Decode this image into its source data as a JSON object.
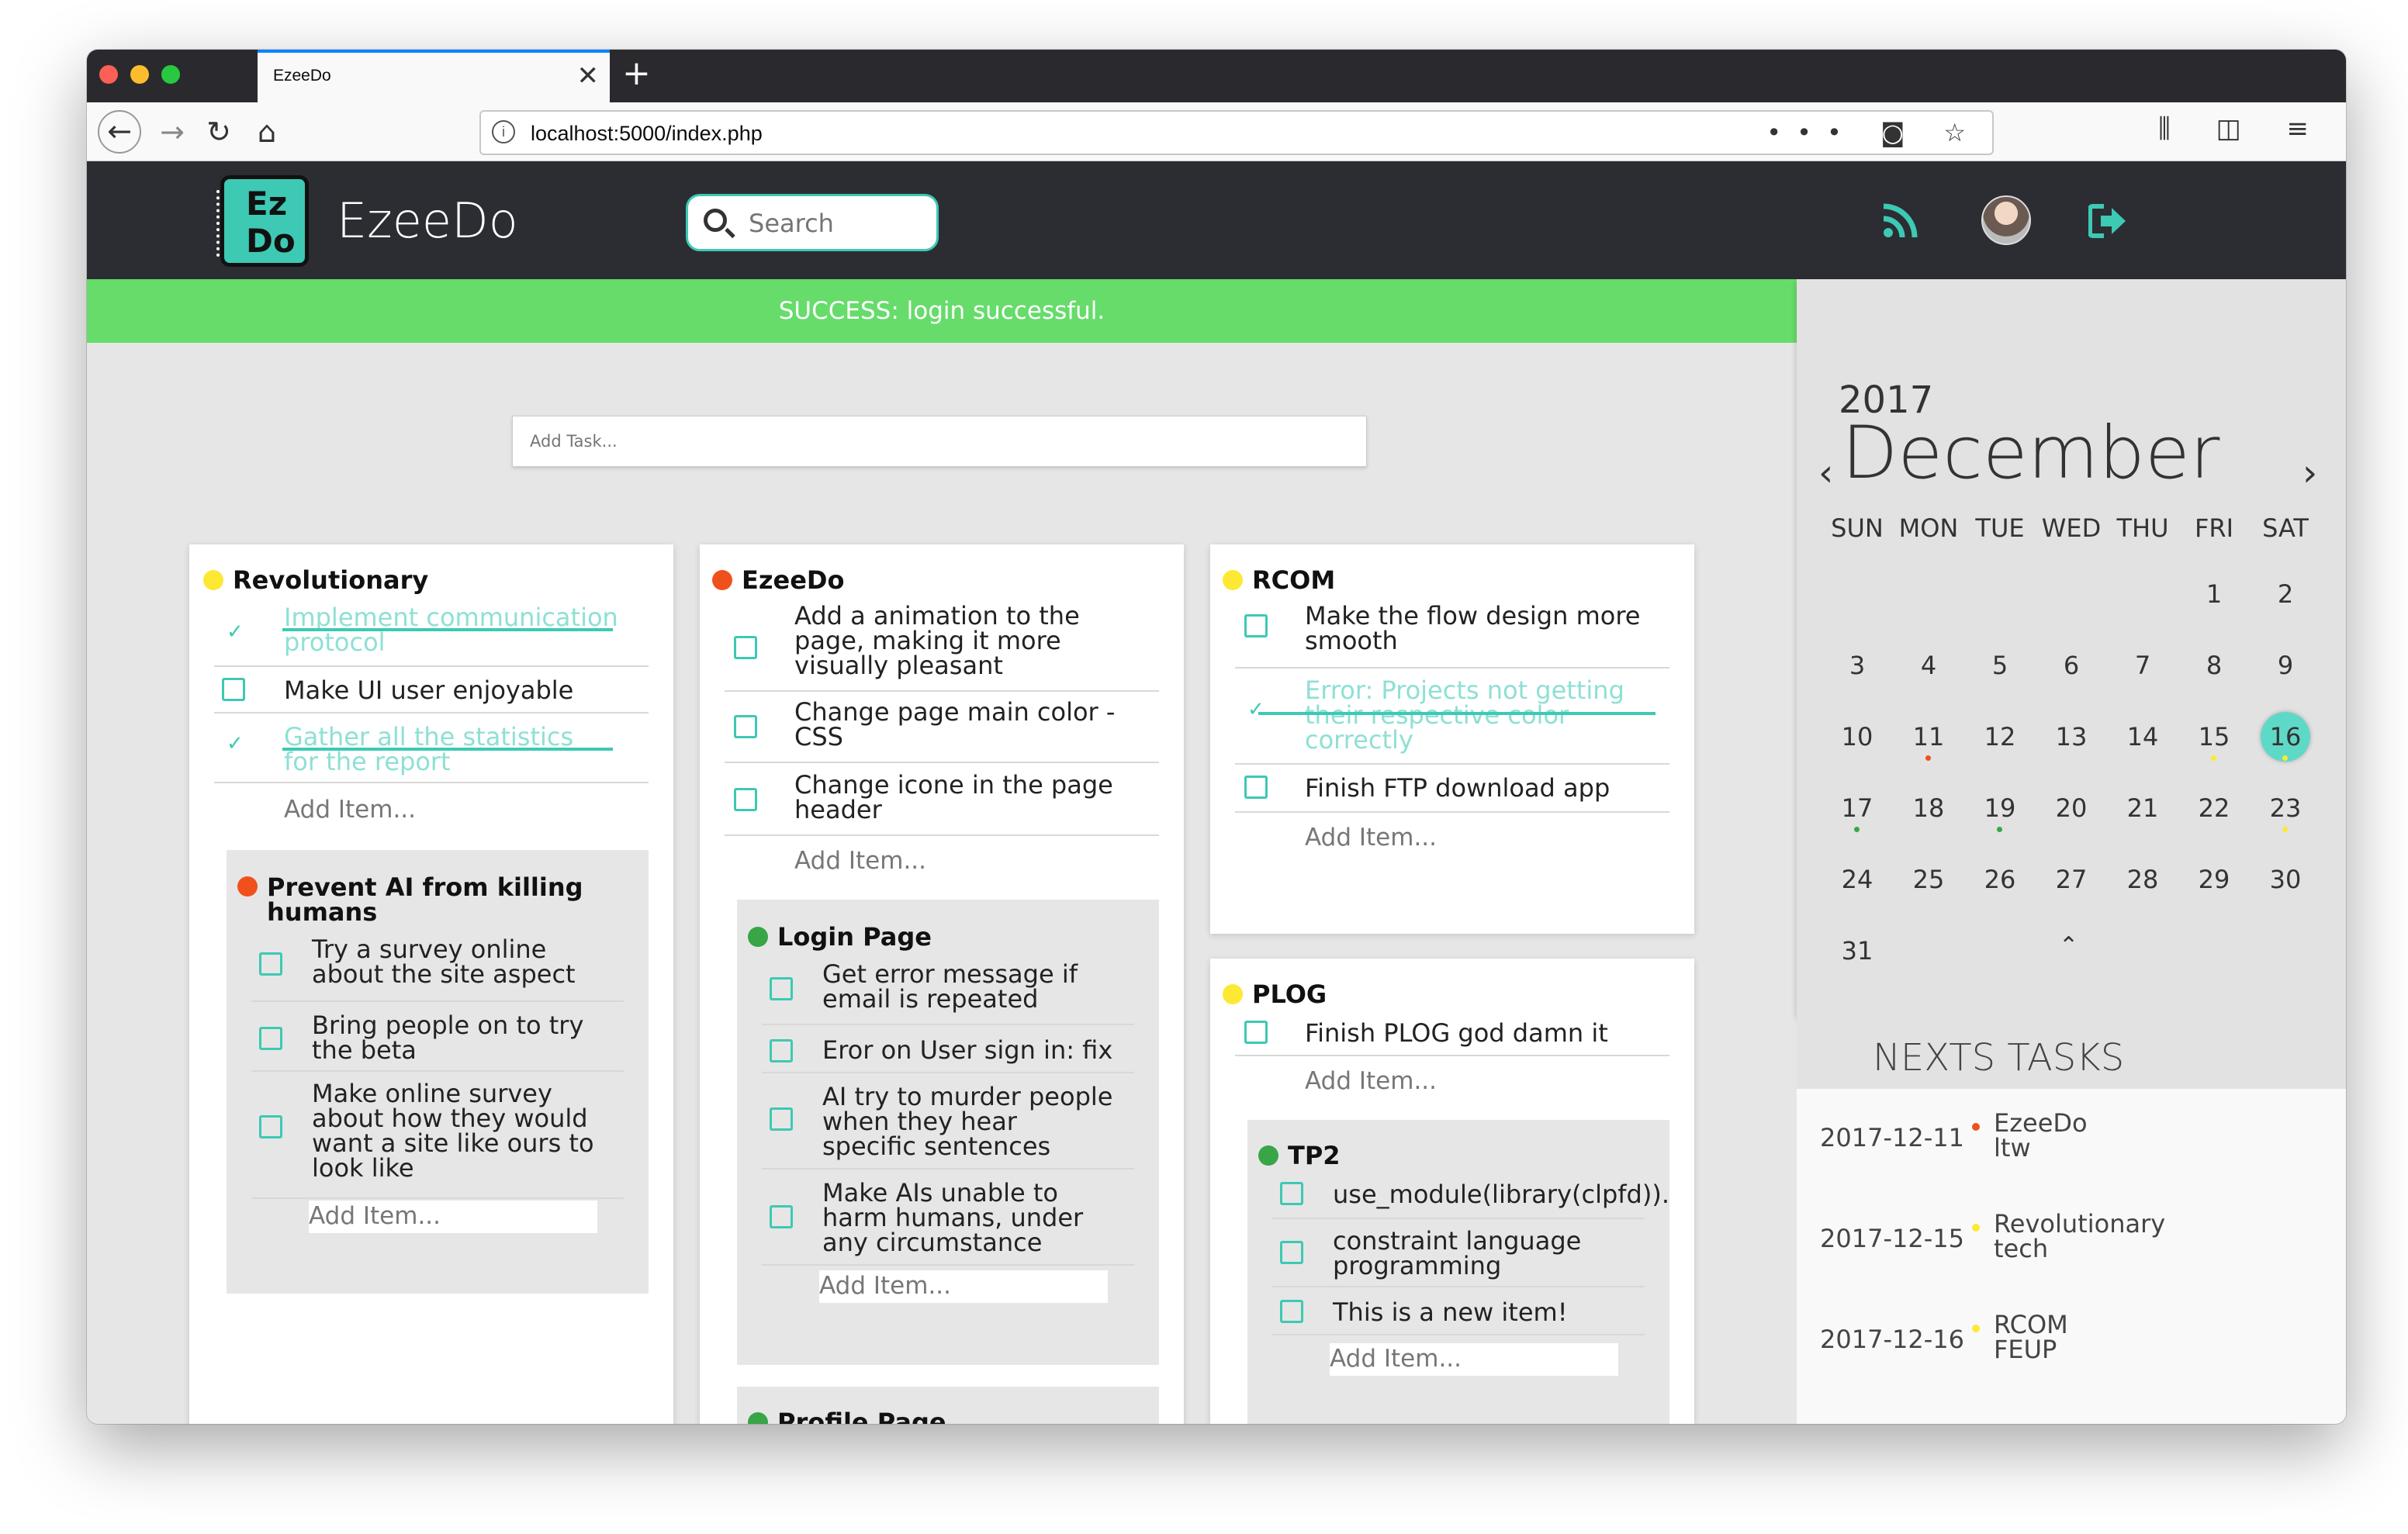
{
  "browser": {
    "tab_title": "EzeeDo",
    "close_glyph": "✕",
    "new_tab_glyph": "+",
    "url": "localhost:5000/index.php",
    "back_glyph": "←",
    "forward_glyph": "→",
    "reload_glyph": "↻",
    "home_glyph": "⌂",
    "info_glyph": "i",
    "url_icons": "••• ◙ ☆",
    "tool_icons": "⫼ ◫ ≡"
  },
  "app": {
    "logo_text": "Ez Do",
    "brand": "EzeeDo",
    "search_placeholder": "Search",
    "accent": "#3dc9b3",
    "header_bg": "#2b2d33"
  },
  "banner": {
    "text": "SUCCESS: login successful.",
    "color": "#66dc6a"
  },
  "add_task": {
    "placeholder": "Add Task..."
  },
  "projects": {
    "revolutionary": {
      "title": "Revolutionary",
      "items": [
        "Implement communication protocol",
        "Make UI user enjoyable",
        "Gather all the statistics for the report"
      ],
      "add_item": "Add Item...",
      "sub": {
        "title": "Prevent AI from killing humans",
        "items": [
          "Try a survey online about the site aspect",
          "Bring people on to try the beta",
          "Make online survey about how they would want a site like ours to look like"
        ],
        "add_item": "Add Item..."
      }
    },
    "ezeedo": {
      "title": "EzeeDo",
      "items": [
        "Add a animation to the page, making it more visually pleasant",
        "Change page main color - CSS",
        "Change icone in the page header"
      ],
      "add_item": "Add Item...",
      "sub": {
        "title": "Login Page",
        "items": [
          "Get error message if email is repeated",
          "Eror on User sign in: fix",
          "AI try to murder people when they hear specific sentences",
          "Make AIs unable to harm humans, under any circumstance"
        ],
        "add_item": "Add Item..."
      },
      "sub2_title": "Profile Page"
    },
    "rcom": {
      "title": "RCOM",
      "items": [
        "Make the flow design more smooth",
        "Error: Projects not getting their respective color correctly",
        "Finish FTP download app"
      ],
      "add_item": "Add Item..."
    },
    "plog": {
      "title": "PLOG",
      "items": [
        "Finish PLOG god damn it"
      ],
      "add_item": "Add Item...",
      "sub": {
        "title": "TP2",
        "items": [
          "use_module(library(clpfd)).",
          "constraint language programming",
          "This is a new item!"
        ],
        "add_item": "Add Item..."
      }
    }
  },
  "calendar": {
    "year": "2017",
    "month": "December",
    "prev": "‹",
    "next": "›",
    "collapse": "⌃",
    "weekdays": [
      "SUN",
      "MON",
      "TUE",
      "WED",
      "THU",
      "FRI",
      "SAT"
    ],
    "days": [
      "1",
      "2",
      "3",
      "4",
      "5",
      "6",
      "7",
      "8",
      "9",
      "10",
      "11",
      "12",
      "13",
      "14",
      "15",
      "16",
      "17",
      "18",
      "19",
      "20",
      "21",
      "22",
      "23",
      "24",
      "25",
      "26",
      "27",
      "28",
      "29",
      "30",
      "31"
    ],
    "today": "16"
  },
  "next_tasks": {
    "title": "NEXTS TASKS",
    "items": [
      {
        "date": "2017-12-11",
        "project": "EzeeDo",
        "task": "ltw",
        "color": "#f0511c"
      },
      {
        "date": "2017-12-15",
        "project": "Revolutionary",
        "task": "tech",
        "color": "#fde933"
      },
      {
        "date": "2017-12-16",
        "project": "RCOM",
        "task": "FEUP",
        "color": "#fde933"
      }
    ]
  }
}
